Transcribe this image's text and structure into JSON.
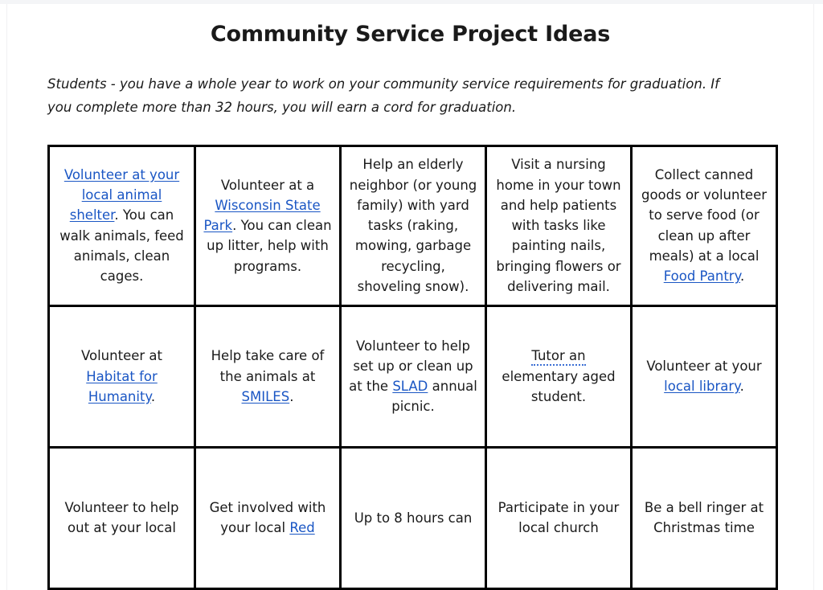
{
  "document": {
    "title": "Community Service Project Ideas",
    "intro": "Students - you have a whole year to work on your community service requirements for graduation. If you complete more than 32 hours, you will earn a cord for graduation."
  },
  "colors": {
    "link": "#1a56c4",
    "text": "#1a1a1a",
    "border": "#000000",
    "page_background": "#ffffff"
  },
  "table": {
    "columns": 5,
    "rows": [
      {
        "cells": [
          {
            "id": "animal-shelter",
            "parts": [
              {
                "text": "Volunteer at your local animal shelter",
                "link": true
              },
              {
                "text": ". You can walk animals, feed animals, clean cages.",
                "link": false
              }
            ]
          },
          {
            "id": "wisconsin-state-park",
            "parts": [
              {
                "text": "Volunteer at a ",
                "link": false
              },
              {
                "text": "Wisconsin State Park",
                "link": true
              },
              {
                "text": ". You can clean up litter, help with programs.",
                "link": false
              }
            ]
          },
          {
            "id": "elderly-neighbor-yard-tasks",
            "parts": [
              {
                "text": "Help an elderly neighbor (or young family) with yard tasks (raking, mowing, garbage recycling, shoveling snow).",
                "link": false
              }
            ]
          },
          {
            "id": "nursing-home-visit",
            "parts": [
              {
                "text": "Visit a nursing home in your town and help patients with tasks like painting nails, bringing flowers or delivering mail.",
                "link": false
              }
            ]
          },
          {
            "id": "food-pantry",
            "parts": [
              {
                "text": "Collect canned goods or volunteer to serve food (or clean up after meals) at a local ",
                "link": false
              },
              {
                "text": "Food Pantry",
                "link": true
              },
              {
                "text": ".",
                "link": false
              }
            ]
          }
        ]
      },
      {
        "cells": [
          {
            "id": "habitat-for-humanity",
            "parts": [
              {
                "text": "Volunteer at ",
                "link": false
              },
              {
                "text": "Habitat for Humanity",
                "link": true
              },
              {
                "text": ".",
                "link": false
              }
            ]
          },
          {
            "id": "smiles-animals",
            "parts": [
              {
                "text": "Help take care of the animals at ",
                "link": false
              },
              {
                "text": "SMILES",
                "link": true
              },
              {
                "text": ".",
                "link": false
              }
            ]
          },
          {
            "id": "slad-annual-picnic",
            "parts": [
              {
                "text": "Volunteer to help set up or clean up at the ",
                "link": false
              },
              {
                "text": "SLAD",
                "link": true
              },
              {
                "text": " annual picnic.",
                "link": false
              }
            ]
          },
          {
            "id": "tutor-elementary-student",
            "parts": [
              {
                "text": "Tutor an",
                "link": false,
                "spellcheck": true
              },
              {
                "text": " elementary aged student.",
                "link": false
              }
            ]
          },
          {
            "id": "local-library",
            "parts": [
              {
                "text": "Volunteer at your ",
                "link": false
              },
              {
                "text": "local library",
                "link": true
              },
              {
                "text": ".",
                "link": false
              }
            ]
          }
        ]
      },
      {
        "cells": [
          {
            "id": "local-volunteer-partial",
            "parts": [
              {
                "text": "Volunteer to help out at your local",
                "link": false
              }
            ]
          },
          {
            "id": "red-cross-partial",
            "parts": [
              {
                "text": "Get involved with your local ",
                "link": false
              },
              {
                "text": "Red",
                "link": true
              }
            ]
          },
          {
            "id": "eight-hours-partial",
            "parts": [
              {
                "text": "Up to 8 hours can",
                "link": false
              }
            ]
          },
          {
            "id": "local-church-partial",
            "parts": [
              {
                "text": "Participate in your local church",
                "link": false
              }
            ]
          },
          {
            "id": "bell-ringer-partial",
            "parts": [
              {
                "text": "Be a bell ringer at Christmas time",
                "link": false
              }
            ]
          }
        ]
      }
    ]
  }
}
